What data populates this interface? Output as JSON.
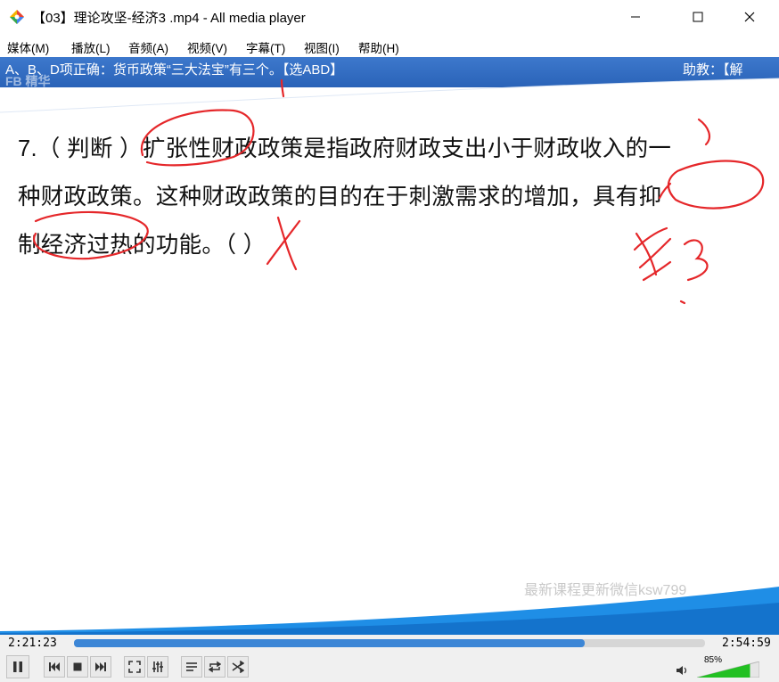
{
  "window": {
    "title": "【03】理论攻坚-经济3 .mp4 - All media player",
    "minimize_glyph": "—",
    "maximize_glyph": "☐",
    "close_glyph": "✕"
  },
  "menu": {
    "items": [
      {
        "label": "媒体(M)"
      },
      {
        "label": "播放(L)"
      },
      {
        "label": "音频(A)"
      },
      {
        "label": "视频(V)"
      },
      {
        "label": "字幕(T)"
      },
      {
        "label": "视图(I)"
      },
      {
        "label": "帮助(H)"
      }
    ]
  },
  "video": {
    "banner_text": "A、B、D项正确：货币政策“三大法宝”有三个。【选ABD】",
    "banner_right": "助教：【解",
    "banner_ghost": "FB 精华",
    "question_lines": [
      "7.（ 判断 ）扩张性财政政策是指政府财政支出小于财政收入的一",
      "种财政政策。这种财政政策的目的在于刺激需求的增加，具有抑",
      "制经济过热的功能。（    ）"
    ],
    "watermark": "最新课程更新微信ksw799",
    "colors": {
      "banner": "#2f6cc2",
      "annotation": "#e5272a",
      "wave": "#1f8ee6"
    }
  },
  "playback": {
    "current_time": "2:21:23",
    "total_time": "2:54:59",
    "progress": 0.81
  },
  "volume": {
    "level_label": "85%",
    "level": 0.85
  },
  "icons": [
    "app-icon",
    "pause-icon",
    "previous-icon",
    "stop-icon",
    "next-icon",
    "fullscreen-icon",
    "equalizer-icon",
    "playlist-icon",
    "repeat-icon",
    "shuffle-icon",
    "speaker-icon"
  ]
}
